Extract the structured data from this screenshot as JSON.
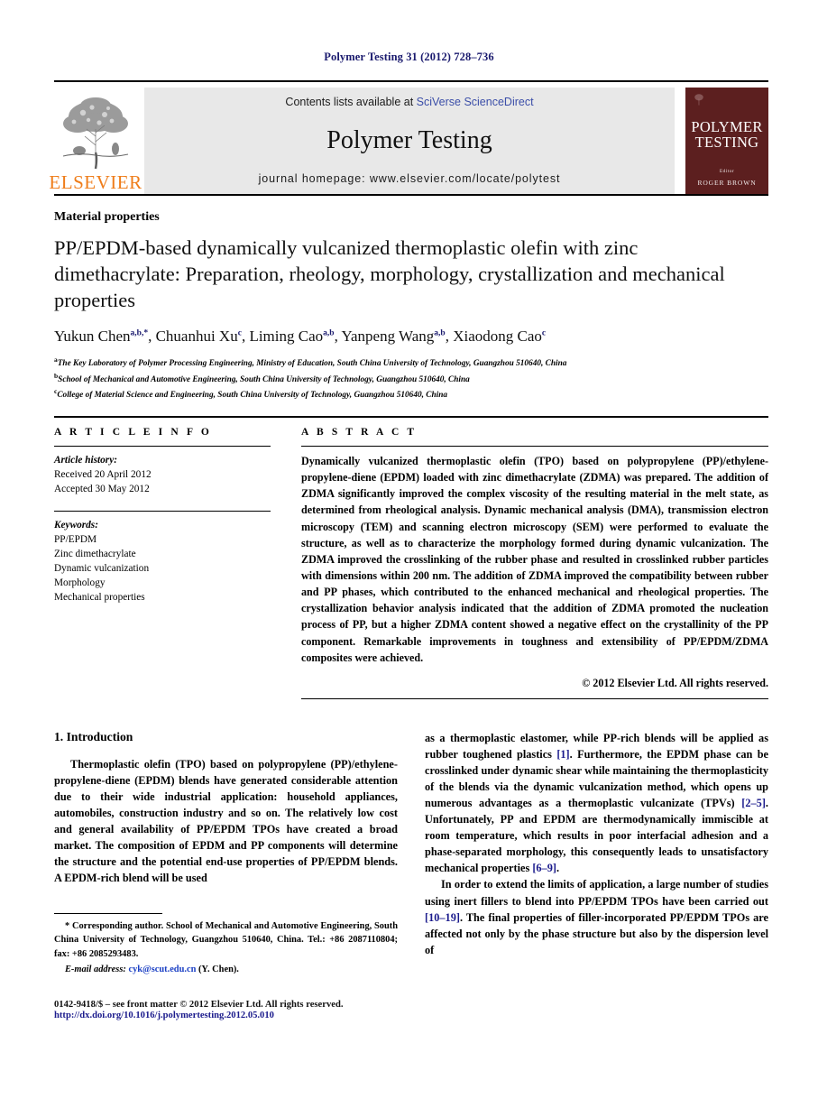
{
  "running_head": "Polymer Testing 31 (2012) 728–736",
  "masthead": {
    "publisher": "ELSEVIER",
    "contents_prefix": "Contents lists available at ",
    "contents_link": "SciVerse ScienceDirect",
    "journal_title": "Polymer Testing",
    "homepage": "journal homepage: www.elsevier.com/locate/polytest",
    "cover": {
      "title_line1": "POLYMER",
      "title_line2": "TESTING",
      "editor_label": "Editor",
      "editor_name": "ROGER BROWN"
    }
  },
  "article": {
    "kicker": "Material properties",
    "title": "PP/EPDM-based dynamically vulcanized thermoplastic olefin with zinc dimethacrylate: Preparation, rheology, morphology, crystallization and mechanical properties",
    "authors": [
      {
        "name": "Yukun Chen",
        "sup": "a,b,*"
      },
      {
        "name": "Chuanhui Xu",
        "sup": "c"
      },
      {
        "name": "Liming Cao",
        "sup": "a,b"
      },
      {
        "name": "Yanpeng Wang",
        "sup": "a,b"
      },
      {
        "name": "Xiaodong Cao",
        "sup": "c"
      }
    ],
    "affiliations": [
      {
        "mark": "a",
        "text": "The Key Laboratory of Polymer Processing Engineering, Ministry of Education, South China University of Technology, Guangzhou 510640, China"
      },
      {
        "mark": "b",
        "text": "School of Mechanical and Automotive Engineering, South China University of Technology, Guangzhou 510640, China"
      },
      {
        "mark": "c",
        "text": "College of Material Science and Engineering, South China University of Technology, Guangzhou 510640, China"
      }
    ]
  },
  "article_info": {
    "heading": "A R T I C L E  I N F O",
    "history_label": "Article history:",
    "history": [
      "Received 20 April 2012",
      "Accepted 30 May 2012"
    ],
    "keywords_label": "Keywords:",
    "keywords": [
      "PP/EPDM",
      "Zinc dimethacrylate",
      "Dynamic vulcanization",
      "Morphology",
      "Mechanical properties"
    ]
  },
  "abstract": {
    "heading": "A B S T R A C T",
    "text": "Dynamically vulcanized thermoplastic olefin (TPO) based on polypropylene (PP)/ethylene-propylene-diene (EPDM) loaded with zinc dimethacrylate (ZDMA) was prepared. The addition of ZDMA significantly improved the complex viscosity of the resulting material in the melt state, as determined from rheological analysis. Dynamic mechanical analysis (DMA), transmission electron microscopy (TEM) and scanning electron microscopy (SEM) were performed to evaluate the structure, as well as to characterize the morphology formed during dynamic vulcanization. The ZDMA improved the crosslinking of the rubber phase and resulted in crosslinked rubber particles with dimensions within 200 nm. The addition of ZDMA improved the compatibility between rubber and PP phases, which contributed to the enhanced mechanical and rheological properties. The crystallization behavior analysis indicated that the addition of ZDMA promoted the nucleation process of PP, but a higher ZDMA content showed a negative effect on the crystallinity of the PP component. Remarkable improvements in toughness and extensibility of PP/EPDM/ZDMA composites were achieved.",
    "copyright": "© 2012 Elsevier Ltd. All rights reserved."
  },
  "body": {
    "section_heading": "1. Introduction",
    "left_paragraph_1": "Thermoplastic olefin (TPO) based on polypropylene (PP)/ethylene-propylene-diene (EPDM) blends have generated considerable attention due to their wide industrial application: household appliances, automobiles, construction industry and so on. The relatively low cost and general availability of PP/EPDM TPOs have created a broad market. The composition of EPDM and PP components will determine the structure and the potential end-use properties of PP/EPDM blends. A EPDM-rich blend will be used",
    "right_paragraph_1_a": "as a thermoplastic elastomer, while PP-rich blends will be applied as rubber toughened plastics ",
    "right_ref_1": "[1]",
    "right_paragraph_1_b": ". Furthermore, the EPDM phase can be crosslinked under dynamic shear while maintaining the thermoplasticity of the blends via the dynamic vulcanization method, which opens up numerous advantages as a thermoplastic vulcanizate (TPVs) ",
    "right_ref_2": "[2–5]",
    "right_paragraph_1_c": ". Unfortunately, PP and EPDM are thermodynamically immiscible at room temperature, which results in poor interfacial adhesion and a phase-separated morphology, this consequently leads to unsatisfactory mechanical properties ",
    "right_ref_3": "[6–9]",
    "right_paragraph_1_d": ".",
    "right_paragraph_2_a": "In order to extend the limits of application, a large number of studies using inert fillers to blend into PP/EPDM TPOs have been carried out ",
    "right_ref_4": "[10–19]",
    "right_paragraph_2_b": ". The final properties of filler-incorporated PP/EPDM TPOs are affected not only by the phase structure but also by the dispersion level of"
  },
  "footnote": {
    "corresponding": "* Corresponding author. School of Mechanical and Automotive Engineering, South China University of Technology, Guangzhou 510640, China. Tel.: +86 2087110804; fax: +86 2085293483.",
    "email_label": "E-mail address:",
    "email": "cyk@scut.edu.cn",
    "email_suffix": "(Y. Chen)."
  },
  "bottom_matter": {
    "issn_line": "0142-9418/$ – see front matter © 2012 Elsevier Ltd. All rights reserved.",
    "doi": "http://dx.doi.org/10.1016/j.polymertesting.2012.05.010"
  }
}
